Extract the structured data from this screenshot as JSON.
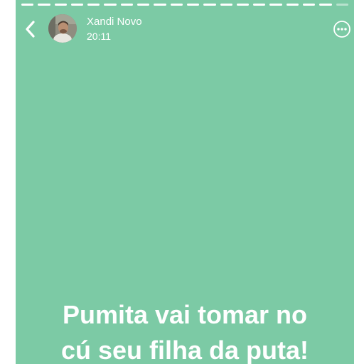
{
  "story": {
    "background_color": "#7ccaa5",
    "progress": {
      "segments_total": 20,
      "segments_completed": 19
    },
    "header": {
      "username": "Xandi Novo",
      "timestamp": "20:11",
      "back_icon": "chevron-left-icon",
      "more_icon": "more-options-icon"
    },
    "caption": {
      "line1": "Pumita vai tomar no",
      "line2": "cú seu filha da puta!"
    }
  }
}
